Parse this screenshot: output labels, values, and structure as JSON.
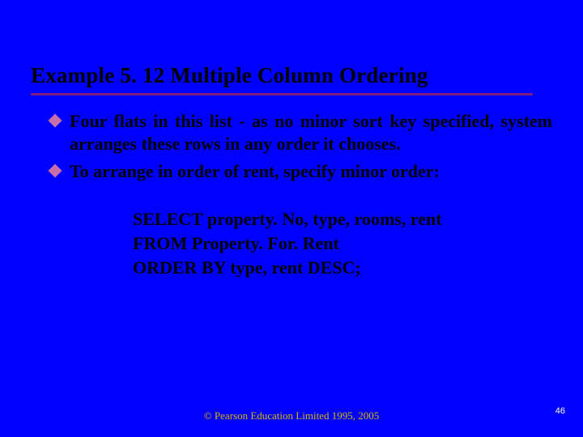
{
  "title": "Example 5. 12  Multiple Column Ordering",
  "bullets": [
    "Four flats in this list - as no minor sort key specified, system arranges these rows in any order it chooses.",
    "To arrange in order of rent, specify minor order:"
  ],
  "sql": {
    "line1": "SELECT property. No, type, rooms, rent",
    "line2": "FROM Property. For. Rent",
    "line3": "ORDER BY type, rent DESC;"
  },
  "footer": "© Pearson Education Limited 1995, 2005",
  "page_number": "46"
}
